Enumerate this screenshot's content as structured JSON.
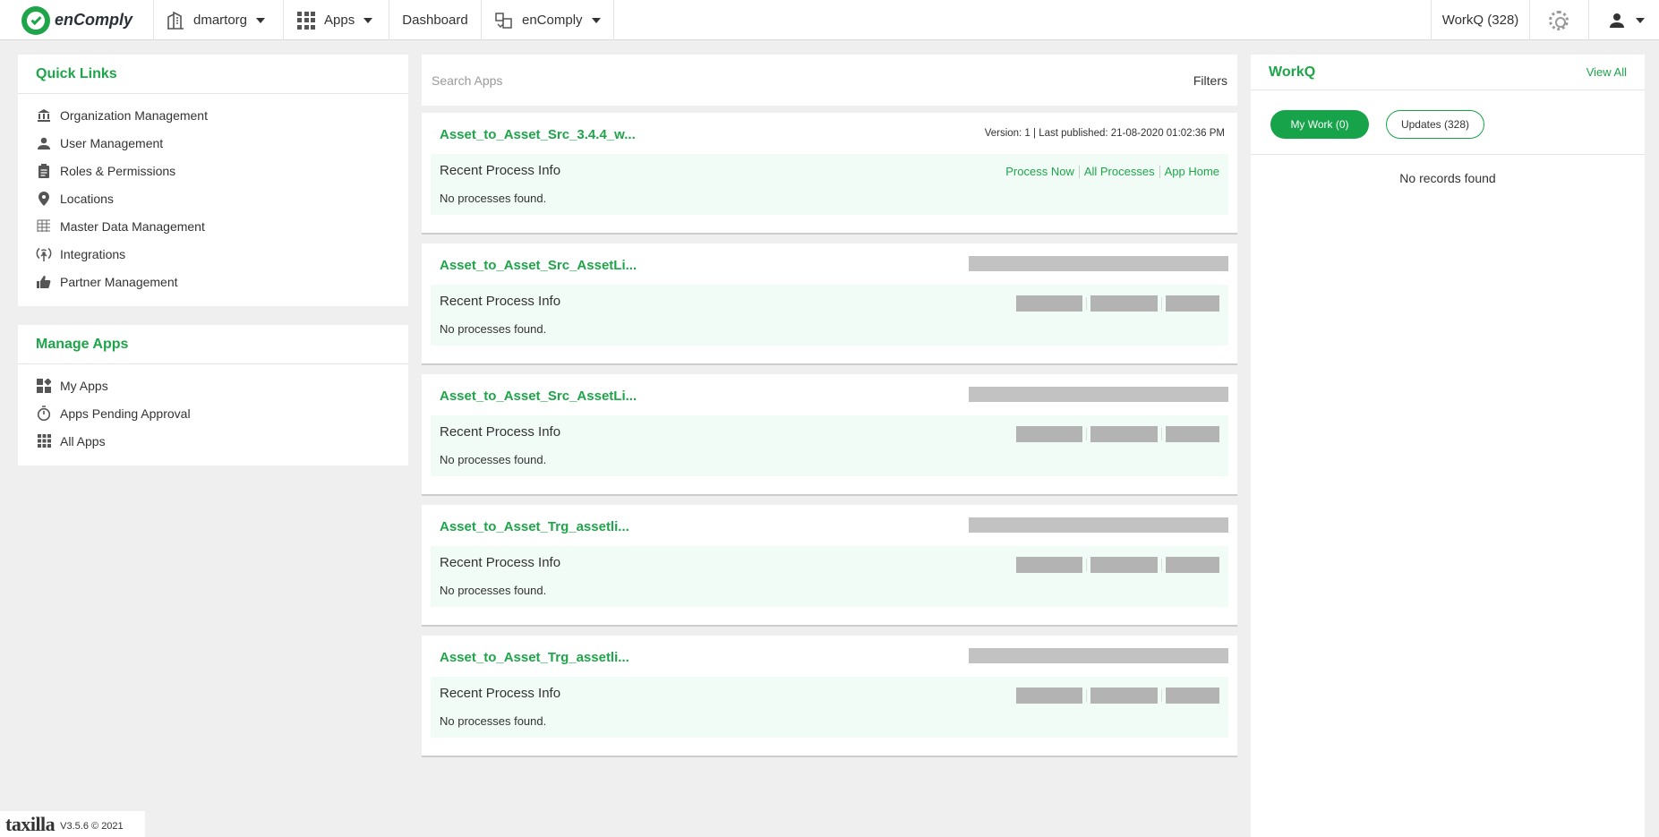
{
  "nav": {
    "brand": "enComply",
    "org": "dmartorg",
    "apps": "Apps",
    "dashboard": "Dashboard",
    "product": "enComply",
    "workq": "WorkQ (328)"
  },
  "quick_links": {
    "title": "Quick Links",
    "items": [
      {
        "label": "Organization Management",
        "icon": "bank-icon"
      },
      {
        "label": "User Management",
        "icon": "user-icon"
      },
      {
        "label": "Roles & Permissions",
        "icon": "clipboard-icon"
      },
      {
        "label": "Locations",
        "icon": "map-pin-icon"
      },
      {
        "label": "Master Data Management",
        "icon": "table-icon"
      },
      {
        "label": "Integrations",
        "icon": "antenna-icon"
      },
      {
        "label": "Partner Management",
        "icon": "thumbs-up-icon"
      }
    ]
  },
  "manage_apps": {
    "title": "Manage Apps",
    "items": [
      {
        "label": "My Apps",
        "icon": "widgets-icon"
      },
      {
        "label": "Apps Pending Approval",
        "icon": "timer-icon"
      },
      {
        "label": "All Apps",
        "icon": "grid-icon"
      }
    ]
  },
  "search": {
    "placeholder": "Search Apps",
    "filters": "Filters"
  },
  "apps": [
    {
      "title": "Asset_to_Asset_Src_3.4.4_w...",
      "meta": "Version: 1 | Last published: 21-08-2020 01:02:36 PM",
      "recent": "Recent Process Info",
      "status": "No processes found.",
      "actions": [
        "Process Now",
        "All Processes",
        "App Home"
      ]
    },
    {
      "title": "Asset_to_Asset_Src_AssetLi...",
      "recent": "Recent Process Info",
      "status": "No processes found."
    },
    {
      "title": "Asset_to_Asset_Src_AssetLi...",
      "recent": "Recent Process Info",
      "status": "No processes found."
    },
    {
      "title": "Asset_to_Asset_Trg_assetli...",
      "recent": "Recent Process Info",
      "status": "No processes found."
    },
    {
      "title": "Asset_to_Asset_Trg_assetli...",
      "recent": "Recent Process Info",
      "status": "No processes found."
    }
  ],
  "workq": {
    "title": "WorkQ",
    "view_all": "View All",
    "tabs": [
      "My Work (0)",
      "Updates (328)"
    ],
    "empty": "No records found"
  },
  "footer": {
    "brand": "taxilla",
    "version": "V3.5.6 © 2021"
  },
  "colors": {
    "accent": "#1ea54a",
    "card_inner": "#f1fcf6",
    "background": "#efefef"
  }
}
